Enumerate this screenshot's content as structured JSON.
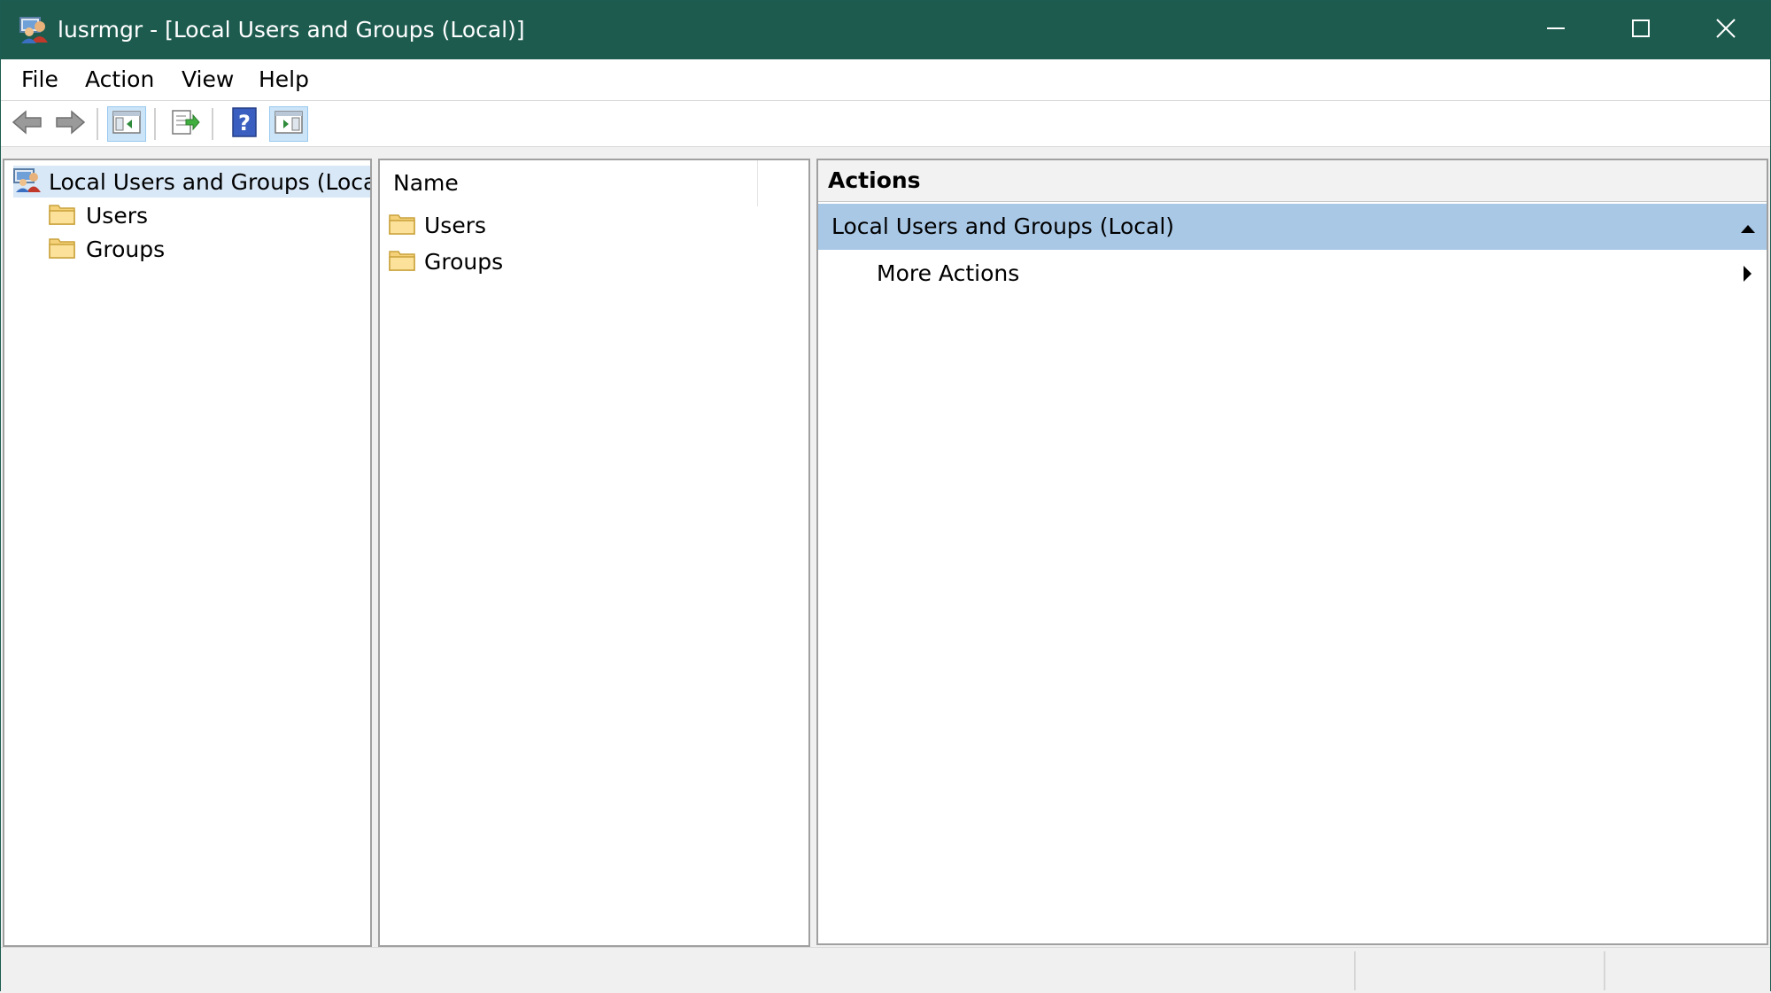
{
  "window": {
    "title": "lusrmgr - [Local Users and Groups (Local)]",
    "titlebar_color": "#1d5b4f",
    "controls": [
      "minimize-icon",
      "maximize-icon",
      "close-icon"
    ]
  },
  "menubar": {
    "items": [
      {
        "label": "File"
      },
      {
        "label": "Action"
      },
      {
        "label": "View"
      },
      {
        "label": "Help"
      }
    ]
  },
  "toolbar": {
    "buttons": [
      "back-arrow-icon",
      "forward-arrow-icon",
      "show-hide-console-tree-icon",
      "export-list-icon",
      "help-icon",
      "show-hide-action-pane-icon"
    ],
    "active": [
      "show-hide-console-tree-icon",
      "show-hide-action-pane-icon"
    ]
  },
  "tree": {
    "root": {
      "label": "Local Users and Groups (Local)",
      "selected": true
    },
    "children": [
      {
        "label": "Users"
      },
      {
        "label": "Groups"
      }
    ]
  },
  "list": {
    "columns": [
      "Name"
    ],
    "rows": [
      {
        "name": "Users"
      },
      {
        "name": "Groups"
      }
    ]
  },
  "actions": {
    "title": "Actions",
    "group_label": "Local Users and Groups (Local)",
    "group_color": "#a9c8e6",
    "items": [
      {
        "label": "More Actions"
      }
    ]
  }
}
